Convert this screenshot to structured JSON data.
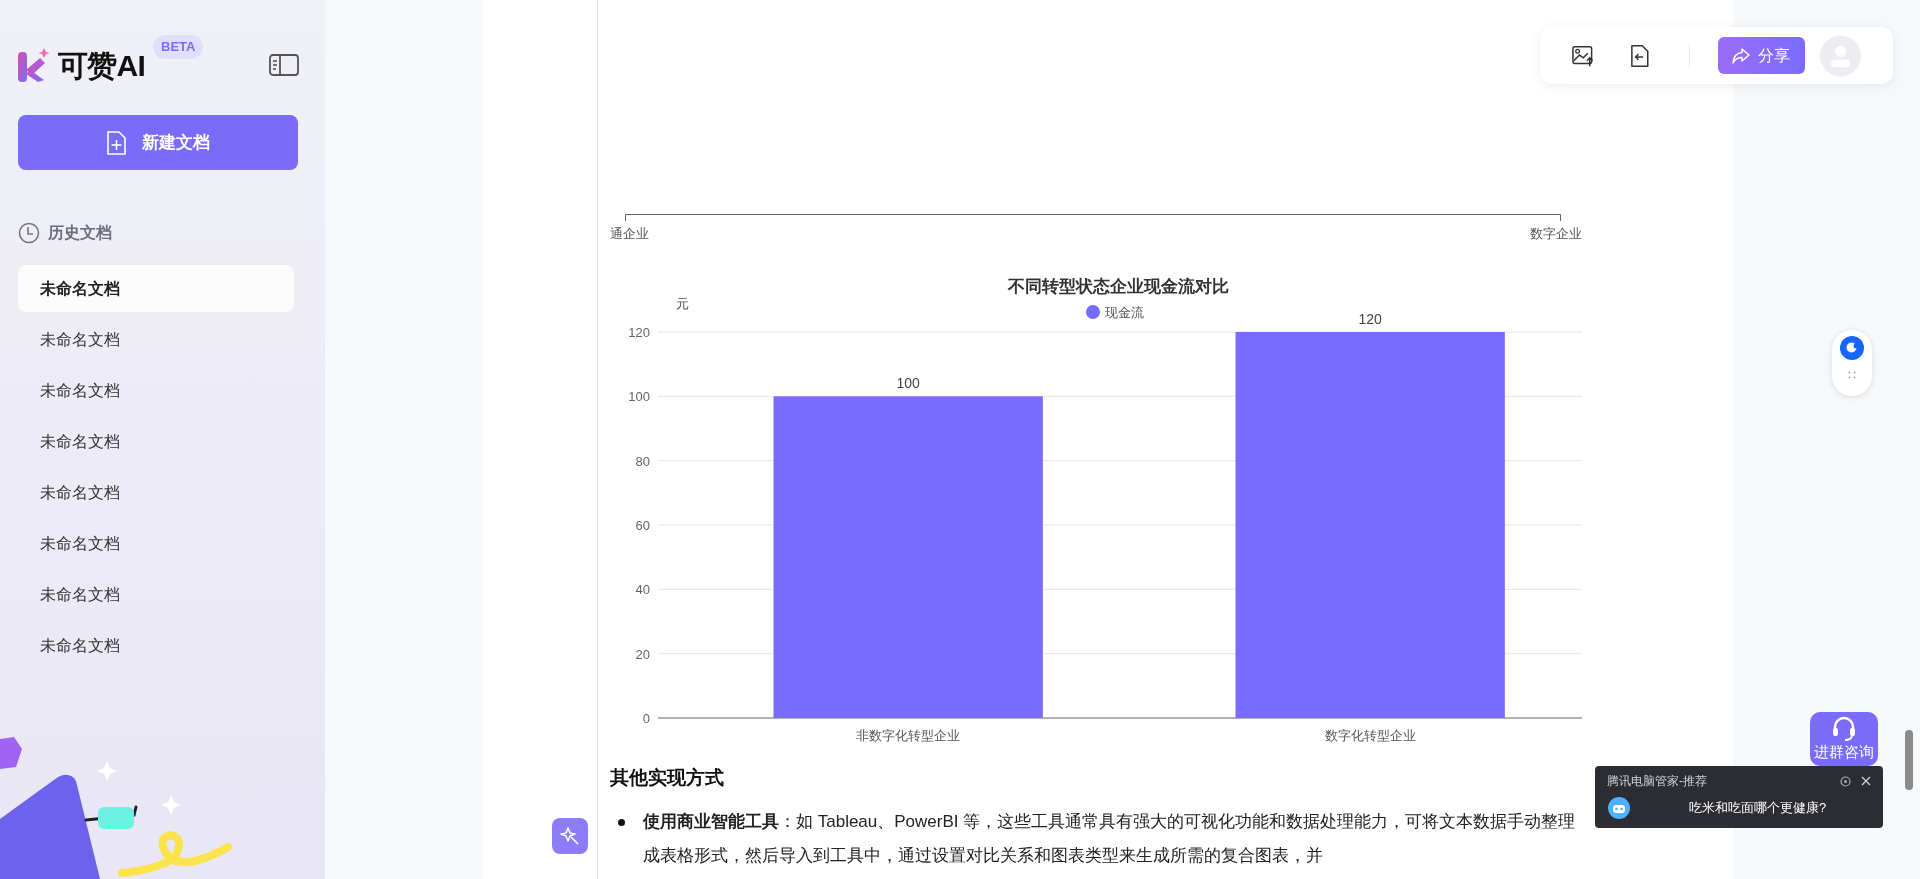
{
  "sidebar": {
    "brand": "可赞AI",
    "badge": "BETA",
    "new_button": "新建文档",
    "history_title": "历史文档",
    "items": [
      {
        "label": "未命名文档",
        "selected": true
      },
      {
        "label": "未命名文档",
        "selected": false
      },
      {
        "label": "未命名文档",
        "selected": false
      },
      {
        "label": "未命名文档",
        "selected": false
      },
      {
        "label": "未命名文档",
        "selected": false
      },
      {
        "label": "未命名文档",
        "selected": false
      },
      {
        "label": "未命名文档",
        "selected": false
      },
      {
        "label": "未命名文档",
        "selected": false
      }
    ]
  },
  "toolbar": {
    "share": "分享"
  },
  "document": {
    "previous_chart": {
      "axis_labels": [
        "通企业",
        "数字企业"
      ]
    },
    "chart": {
      "chart_data": {
        "type": "bar",
        "title": "不同转型状态企业现金流对比",
        "ylabel": "元",
        "categories": [
          "非数字化转型企业",
          "数字化转型企业"
        ],
        "series": [
          {
            "name": "现金流",
            "color": "#786cff",
            "values": [
              100,
              120
            ]
          }
        ],
        "ylim": [
          0,
          120
        ],
        "yticks": [
          0,
          20,
          40,
          60,
          80,
          100,
          120
        ],
        "data_labels": true,
        "grid": true
      }
    },
    "heading": "其他实现方式",
    "bullets": [
      "**使用商业智能工具**：如 Tableau、PowerBI 等，这些工具通常具有强大的可视化功能和数据处理能力，可将文本数据手动整理成表格形式，然后导入到工具中，通过设置对比关系和图表类型来生成所需的复合图表，并"
    ]
  },
  "float": {
    "consult": "进群咨询"
  },
  "notification": {
    "title": "腾讯电脑管家-推荐",
    "message": "吃米和吃面哪个更健康?"
  }
}
